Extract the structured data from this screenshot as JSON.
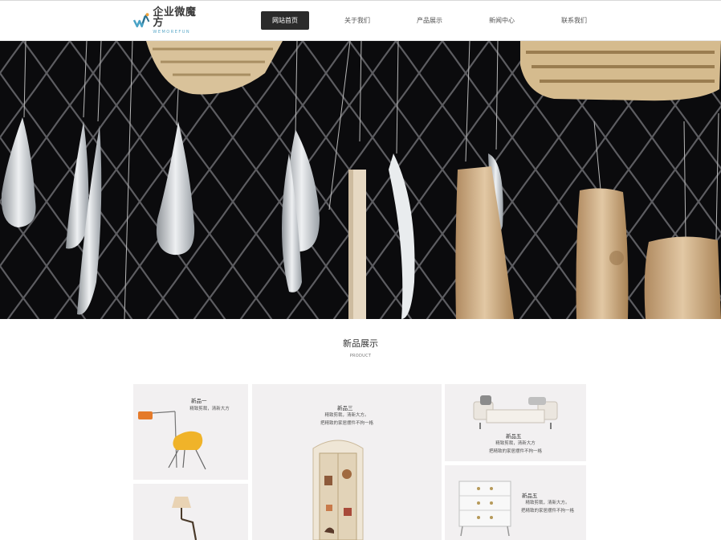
{
  "header": {
    "logo_cn": "企业微魔方",
    "logo_en": "WEMOREFUN",
    "nav": [
      {
        "label": "网站首页",
        "active": true
      },
      {
        "label": "关于我们",
        "active": false
      },
      {
        "label": "产品展示",
        "active": false
      },
      {
        "label": "新闻中心",
        "active": false
      },
      {
        "label": "联系我们",
        "active": false
      }
    ]
  },
  "products_section": {
    "title": "新品展示",
    "subtitle": "PRODUCT"
  },
  "products": [
    {
      "name": "新品一",
      "desc1": "精致剪裁，清新大方",
      "desc2": ""
    },
    {
      "name": "新品三",
      "desc1": "精致剪裁，清新大方。",
      "desc2": "把精致的家居摆件不拘一格"
    },
    {
      "name": "新品五",
      "desc1": "精致剪裁，清新大方",
      "desc2": "把精致的家居摆件不拘一格"
    },
    {
      "name": "新品五",
      "desc1": "精致剪裁，清新大方。",
      "desc2": "把精致的家居摆件不拘一格"
    }
  ],
  "colors": {
    "nav_active_bg": "#2b2b2b",
    "banner_bg": "#0b0b0d",
    "card_bg": "#f2f0f1",
    "logo_accent": "#5aa8c8"
  }
}
